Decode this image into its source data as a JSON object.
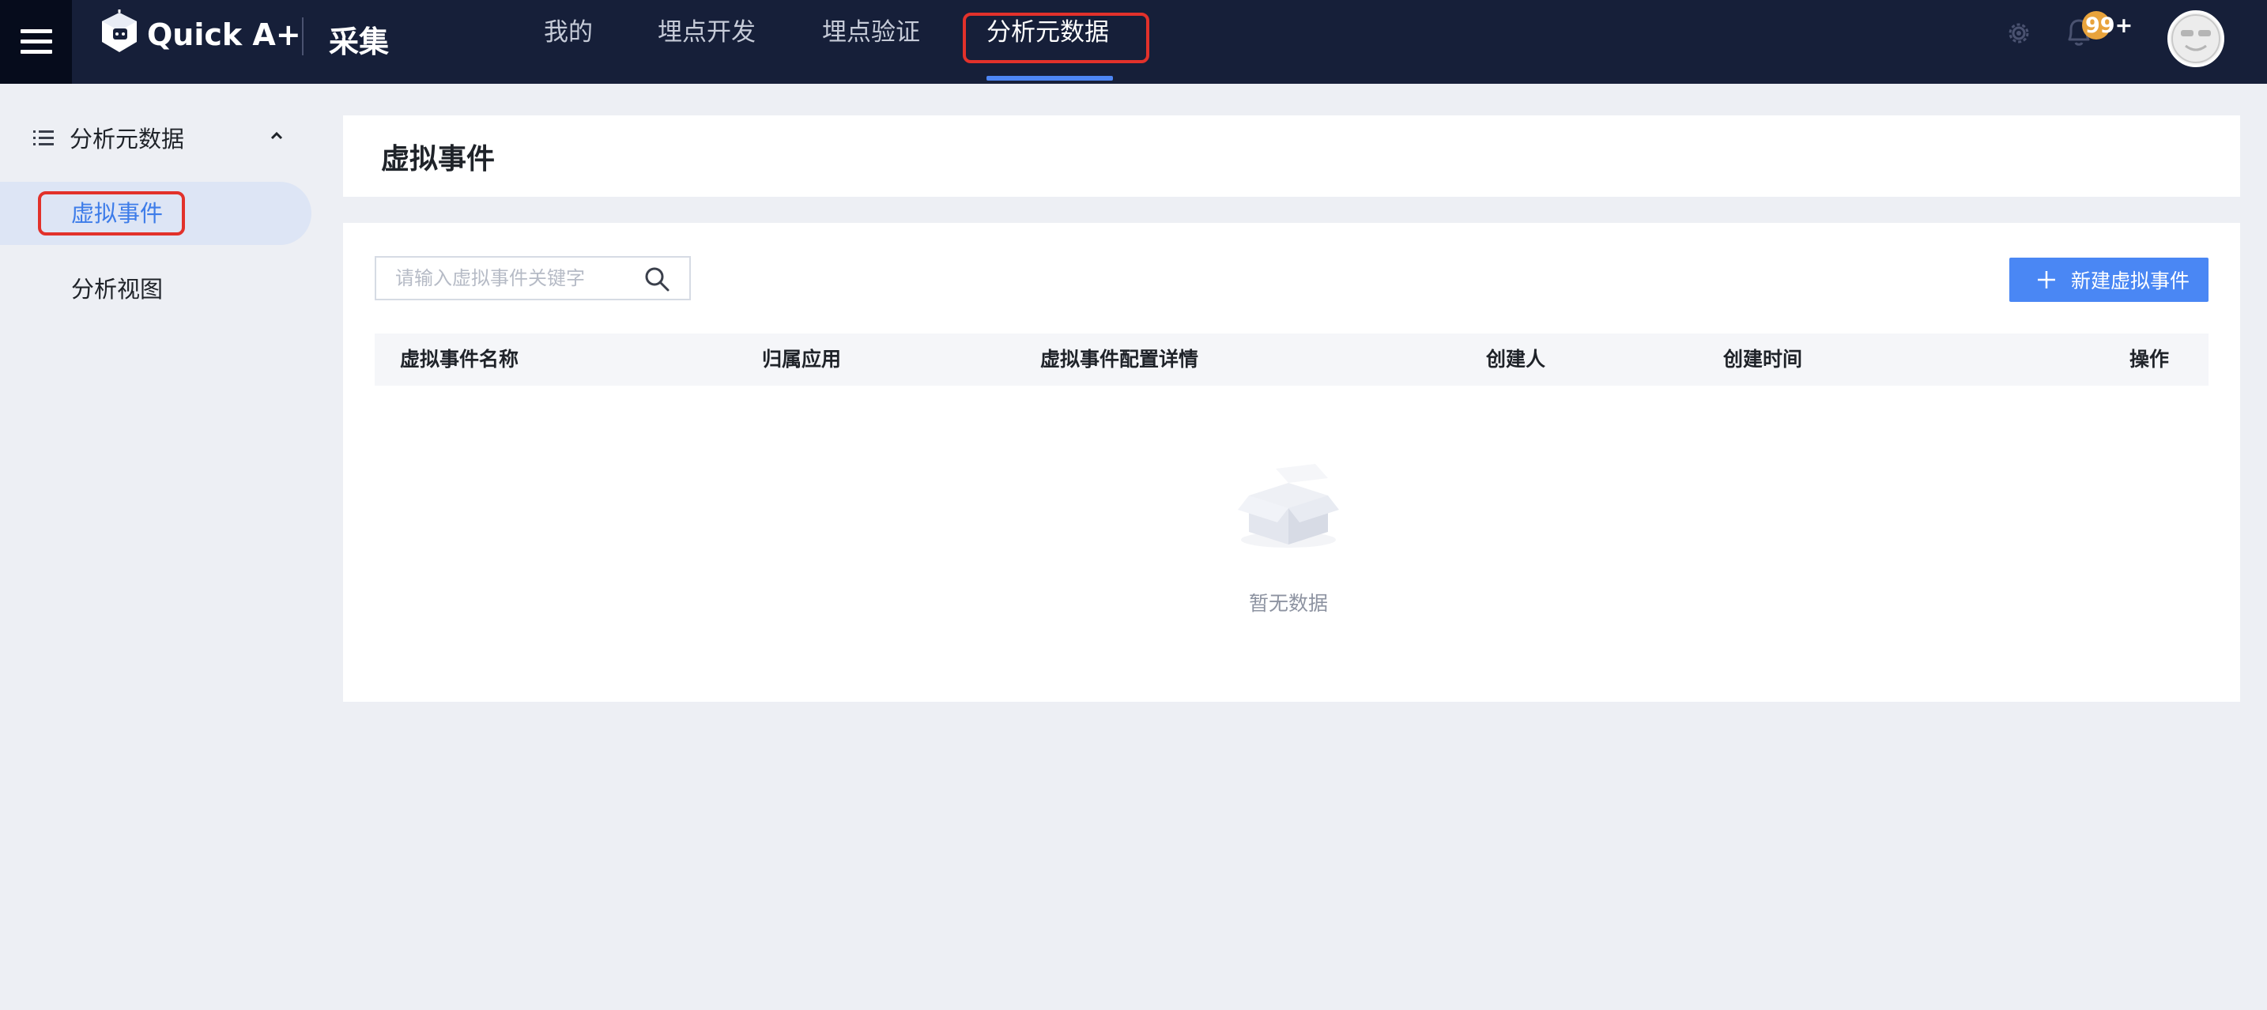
{
  "header": {
    "brand": "Quick A+",
    "module": "采集",
    "tabs": [
      {
        "label": "我的"
      },
      {
        "label": "埋点开发"
      },
      {
        "label": "埋点验证"
      },
      {
        "label": "分析元数据",
        "active": true
      }
    ],
    "notifications_badge": "99+",
    "icons": [
      "menu-icon",
      "logo-icon",
      "gear-icon",
      "bell-icon",
      "avatar"
    ]
  },
  "sidebar": {
    "group_label": "分析元数据",
    "group_expanded": true,
    "items": [
      {
        "label": "虚拟事件",
        "selected": true
      },
      {
        "label": "分析视图",
        "selected": false
      }
    ]
  },
  "main": {
    "page_title": "虚拟事件",
    "search": {
      "placeholder": "请输入虚拟事件关键字",
      "value": ""
    },
    "new_button_label": "新建虚拟事件",
    "table": {
      "columns": [
        "虚拟事件名称",
        "归属应用",
        "虚拟事件配置详情",
        "创建人",
        "创建时间",
        "操作"
      ],
      "rows": []
    },
    "empty_text": "暂无数据"
  },
  "colors": {
    "topbar_bg": "#161f39",
    "accent": "#4a87f4",
    "highlight_box": "#e2312b",
    "badge": "#e8a33c",
    "page_bg": "#edeff4"
  }
}
